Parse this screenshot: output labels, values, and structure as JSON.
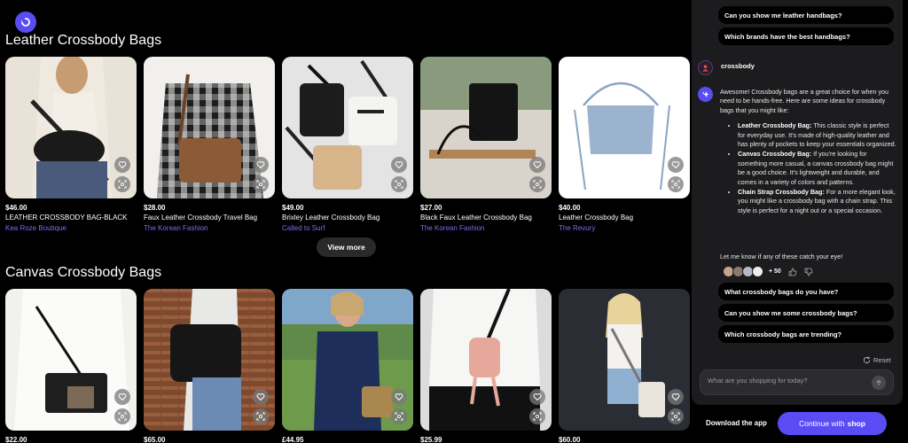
{
  "brand": {
    "logo_letter": "D",
    "accent": "#5a4cf5"
  },
  "sections": [
    {
      "title": "Leather Crossbody Bags",
      "products": [
        {
          "price": "$46.00",
          "name": "LEATHER CROSSBODY BAG-BLACK",
          "store": "Kea Roze Boutique"
        },
        {
          "price": "$28.00",
          "name": "Faux Leather Crossbody Travel Bag",
          "store": "The Korean Fashion"
        },
        {
          "price": "$49.00",
          "name": "Brixley Leather Crossbody Bag",
          "store": "Called to Surf"
        },
        {
          "price": "$27.00",
          "name": "Black Faux Leather Crossbody Bag",
          "store": "The Korean Fashion"
        },
        {
          "price": "$40.00",
          "name": "Leather Crossbody Bag",
          "store": "The Revury"
        }
      ],
      "view_more": "View more"
    },
    {
      "title": "Canvas Crossbody Bags",
      "products": [
        {
          "price": "$22.00"
        },
        {
          "price": "$65.00"
        },
        {
          "price": "£44.95"
        },
        {
          "price": "$25.99"
        },
        {
          "price": "$60.00"
        }
      ]
    }
  ],
  "chat": {
    "top_suggestions": [
      "Can you show me leather handbags?",
      "Which brands have the best handbags?"
    ],
    "user_message": "crossbody",
    "bot_intro": "Awesome! Crossbody bags are a great choice for when you need to be hands-free. Here are some ideas for crossbody bags that you might like:",
    "bot_items": [
      {
        "title": "Leather Crossbody Bag:",
        "text": " This classic style is perfect for everyday use. It's made of high-quality leather and has plenty of pockets to keep your essentials organized."
      },
      {
        "title": "Canvas Crossbody Bag:",
        "text": " If you're looking for something more casual, a canvas crossbody bag might be a good choice. It's lightweight and durable, and comes in a variety of colors and patterns."
      },
      {
        "title": "Chain Strap Crossbody Bag:",
        "text": " For a more elegant look, you might like a crossbody bag with a chain strap. This style is perfect for a night out or a special occasion."
      }
    ],
    "bot_outro": "Let me know if any of these catch your eye!",
    "reaction_count": "+ 50",
    "bottom_suggestions": [
      "What crossbody bags do you have?",
      "Can you show me some crossbody bags?",
      "Which crossbody bags are trending?"
    ],
    "reset_label": "Reset",
    "input_placeholder": "What are you shopping for today?"
  },
  "footer": {
    "download_label": "Download the app",
    "continue_label": "Continue with",
    "continue_brand": "shop"
  }
}
